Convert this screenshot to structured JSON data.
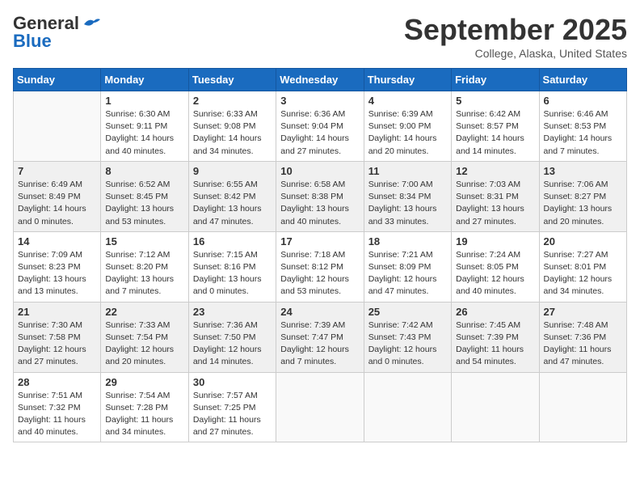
{
  "header": {
    "logo_general": "General",
    "logo_blue": "Blue",
    "month_title": "September 2025",
    "location": "College, Alaska, United States"
  },
  "weekdays": [
    "Sunday",
    "Monday",
    "Tuesday",
    "Wednesday",
    "Thursday",
    "Friday",
    "Saturday"
  ],
  "weeks": [
    [
      {
        "day": "",
        "info": ""
      },
      {
        "day": "1",
        "info": "Sunrise: 6:30 AM\nSunset: 9:11 PM\nDaylight: 14 hours\nand 40 minutes."
      },
      {
        "day": "2",
        "info": "Sunrise: 6:33 AM\nSunset: 9:08 PM\nDaylight: 14 hours\nand 34 minutes."
      },
      {
        "day": "3",
        "info": "Sunrise: 6:36 AM\nSunset: 9:04 PM\nDaylight: 14 hours\nand 27 minutes."
      },
      {
        "day": "4",
        "info": "Sunrise: 6:39 AM\nSunset: 9:00 PM\nDaylight: 14 hours\nand 20 minutes."
      },
      {
        "day": "5",
        "info": "Sunrise: 6:42 AM\nSunset: 8:57 PM\nDaylight: 14 hours\nand 14 minutes."
      },
      {
        "day": "6",
        "info": "Sunrise: 6:46 AM\nSunset: 8:53 PM\nDaylight: 14 hours\nand 7 minutes."
      }
    ],
    [
      {
        "day": "7",
        "info": "Sunrise: 6:49 AM\nSunset: 8:49 PM\nDaylight: 14 hours\nand 0 minutes."
      },
      {
        "day": "8",
        "info": "Sunrise: 6:52 AM\nSunset: 8:45 PM\nDaylight: 13 hours\nand 53 minutes."
      },
      {
        "day": "9",
        "info": "Sunrise: 6:55 AM\nSunset: 8:42 PM\nDaylight: 13 hours\nand 47 minutes."
      },
      {
        "day": "10",
        "info": "Sunrise: 6:58 AM\nSunset: 8:38 PM\nDaylight: 13 hours\nand 40 minutes."
      },
      {
        "day": "11",
        "info": "Sunrise: 7:00 AM\nSunset: 8:34 PM\nDaylight: 13 hours\nand 33 minutes."
      },
      {
        "day": "12",
        "info": "Sunrise: 7:03 AM\nSunset: 8:31 PM\nDaylight: 13 hours\nand 27 minutes."
      },
      {
        "day": "13",
        "info": "Sunrise: 7:06 AM\nSunset: 8:27 PM\nDaylight: 13 hours\nand 20 minutes."
      }
    ],
    [
      {
        "day": "14",
        "info": "Sunrise: 7:09 AM\nSunset: 8:23 PM\nDaylight: 13 hours\nand 13 minutes."
      },
      {
        "day": "15",
        "info": "Sunrise: 7:12 AM\nSunset: 8:20 PM\nDaylight: 13 hours\nand 7 minutes."
      },
      {
        "day": "16",
        "info": "Sunrise: 7:15 AM\nSunset: 8:16 PM\nDaylight: 13 hours\nand 0 minutes."
      },
      {
        "day": "17",
        "info": "Sunrise: 7:18 AM\nSunset: 8:12 PM\nDaylight: 12 hours\nand 53 minutes."
      },
      {
        "day": "18",
        "info": "Sunrise: 7:21 AM\nSunset: 8:09 PM\nDaylight: 12 hours\nand 47 minutes."
      },
      {
        "day": "19",
        "info": "Sunrise: 7:24 AM\nSunset: 8:05 PM\nDaylight: 12 hours\nand 40 minutes."
      },
      {
        "day": "20",
        "info": "Sunrise: 7:27 AM\nSunset: 8:01 PM\nDaylight: 12 hours\nand 34 minutes."
      }
    ],
    [
      {
        "day": "21",
        "info": "Sunrise: 7:30 AM\nSunset: 7:58 PM\nDaylight: 12 hours\nand 27 minutes."
      },
      {
        "day": "22",
        "info": "Sunrise: 7:33 AM\nSunset: 7:54 PM\nDaylight: 12 hours\nand 20 minutes."
      },
      {
        "day": "23",
        "info": "Sunrise: 7:36 AM\nSunset: 7:50 PM\nDaylight: 12 hours\nand 14 minutes."
      },
      {
        "day": "24",
        "info": "Sunrise: 7:39 AM\nSunset: 7:47 PM\nDaylight: 12 hours\nand 7 minutes."
      },
      {
        "day": "25",
        "info": "Sunrise: 7:42 AM\nSunset: 7:43 PM\nDaylight: 12 hours\nand 0 minutes."
      },
      {
        "day": "26",
        "info": "Sunrise: 7:45 AM\nSunset: 7:39 PM\nDaylight: 11 hours\nand 54 minutes."
      },
      {
        "day": "27",
        "info": "Sunrise: 7:48 AM\nSunset: 7:36 PM\nDaylight: 11 hours\nand 47 minutes."
      }
    ],
    [
      {
        "day": "28",
        "info": "Sunrise: 7:51 AM\nSunset: 7:32 PM\nDaylight: 11 hours\nand 40 minutes."
      },
      {
        "day": "29",
        "info": "Sunrise: 7:54 AM\nSunset: 7:28 PM\nDaylight: 11 hours\nand 34 minutes."
      },
      {
        "day": "30",
        "info": "Sunrise: 7:57 AM\nSunset: 7:25 PM\nDaylight: 11 hours\nand 27 minutes."
      },
      {
        "day": "",
        "info": ""
      },
      {
        "day": "",
        "info": ""
      },
      {
        "day": "",
        "info": ""
      },
      {
        "day": "",
        "info": ""
      }
    ]
  ]
}
